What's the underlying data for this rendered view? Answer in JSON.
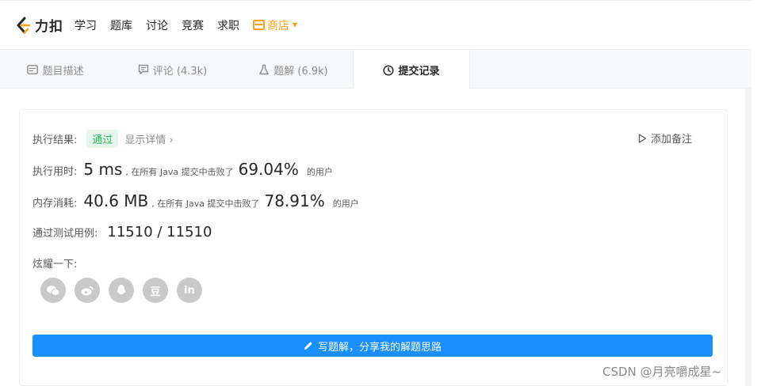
{
  "nav": {
    "logo_text": "力扣",
    "items": [
      "学习",
      "题库",
      "讨论",
      "竞赛",
      "求职"
    ],
    "store_label": "商店"
  },
  "tabs": [
    {
      "label": "题目描述",
      "icon": "description-icon"
    },
    {
      "label": "评论 (4.3k)",
      "icon": "comment-icon"
    },
    {
      "label": "题解 (6.9k)",
      "icon": "flask-icon"
    },
    {
      "label": "提交记录",
      "icon": "clock-icon",
      "active": true
    }
  ],
  "result": {
    "label": "执行结果:",
    "status": "通过",
    "detail_link": "显示详情 ›",
    "add_note": "添加备注"
  },
  "runtime": {
    "label": "执行用时:",
    "value": "5 ms",
    "prefix": ", 在所有 Java 提交中击败了",
    "percent": "69.04%",
    "suffix": "的用户"
  },
  "memory": {
    "label": "内存消耗:",
    "value": "40.6 MB",
    "prefix": ", 在所有 Java 提交中击败了",
    "percent": "78.91%",
    "suffix": "的用户"
  },
  "testcases": {
    "label": "通过测试用例:",
    "value": "11510 / 11510"
  },
  "share": {
    "label": "炫耀一下:",
    "icons": [
      "wechat-icon",
      "weibo-icon",
      "qq-icon",
      "douban-icon",
      "linkedin-icon"
    ],
    "douban_glyph": "豆",
    "linkedin_glyph": "in"
  },
  "write_button": "写题解，分享我的解题思路",
  "watermark": "CSDN @月亮嚼成星~",
  "colors": {
    "pass_green": "#2db55d",
    "store_orange": "#ffa116",
    "button_blue": "#1a90ff"
  }
}
